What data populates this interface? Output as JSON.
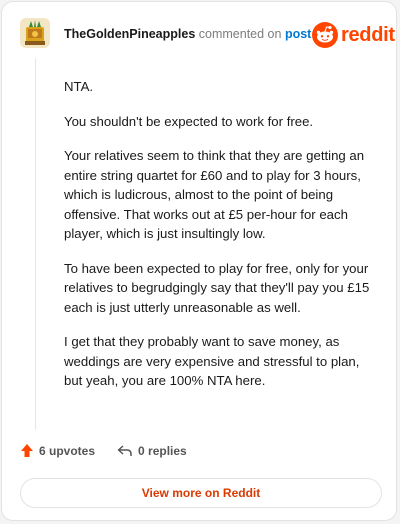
{
  "header": {
    "username": "TheGoldenPineapples",
    "action_text": "commented on",
    "post_link": "post",
    "brand": "reddit",
    "avatar_icon": "golden-pineapple-avatar-icon",
    "brand_icon": "reddit-snoo-icon"
  },
  "comment": {
    "paragraphs": [
      "NTA.",
      "You shouldn't be expected to work for free.",
      "Your relatives seem to think that they are getting an entire string quartet for £60 and to play for 3 hours, which is ludicrous, almost to the point of being offensive. That works out at £5 per-hour for each player, which is just insultingly low.",
      "To have been expected to play for free, only for your relatives to begrudgingly say that they'll pay you £15 each is just utterly unreasonable as well.",
      "I get that they probably want to save money, as weddings are very expensive and stressful to plan, but yeah, you are 100% NTA here."
    ]
  },
  "actions": {
    "upvotes": "6 upvotes",
    "replies": "0 replies",
    "upvote_icon": "upvote-arrow-icon",
    "reply_icon": "reply-arrow-icon"
  },
  "footer": {
    "view_more": "View more on Reddit"
  },
  "colors": {
    "brand": "#ff4500",
    "link": "#0079d3",
    "view_more": "#d93a00"
  }
}
